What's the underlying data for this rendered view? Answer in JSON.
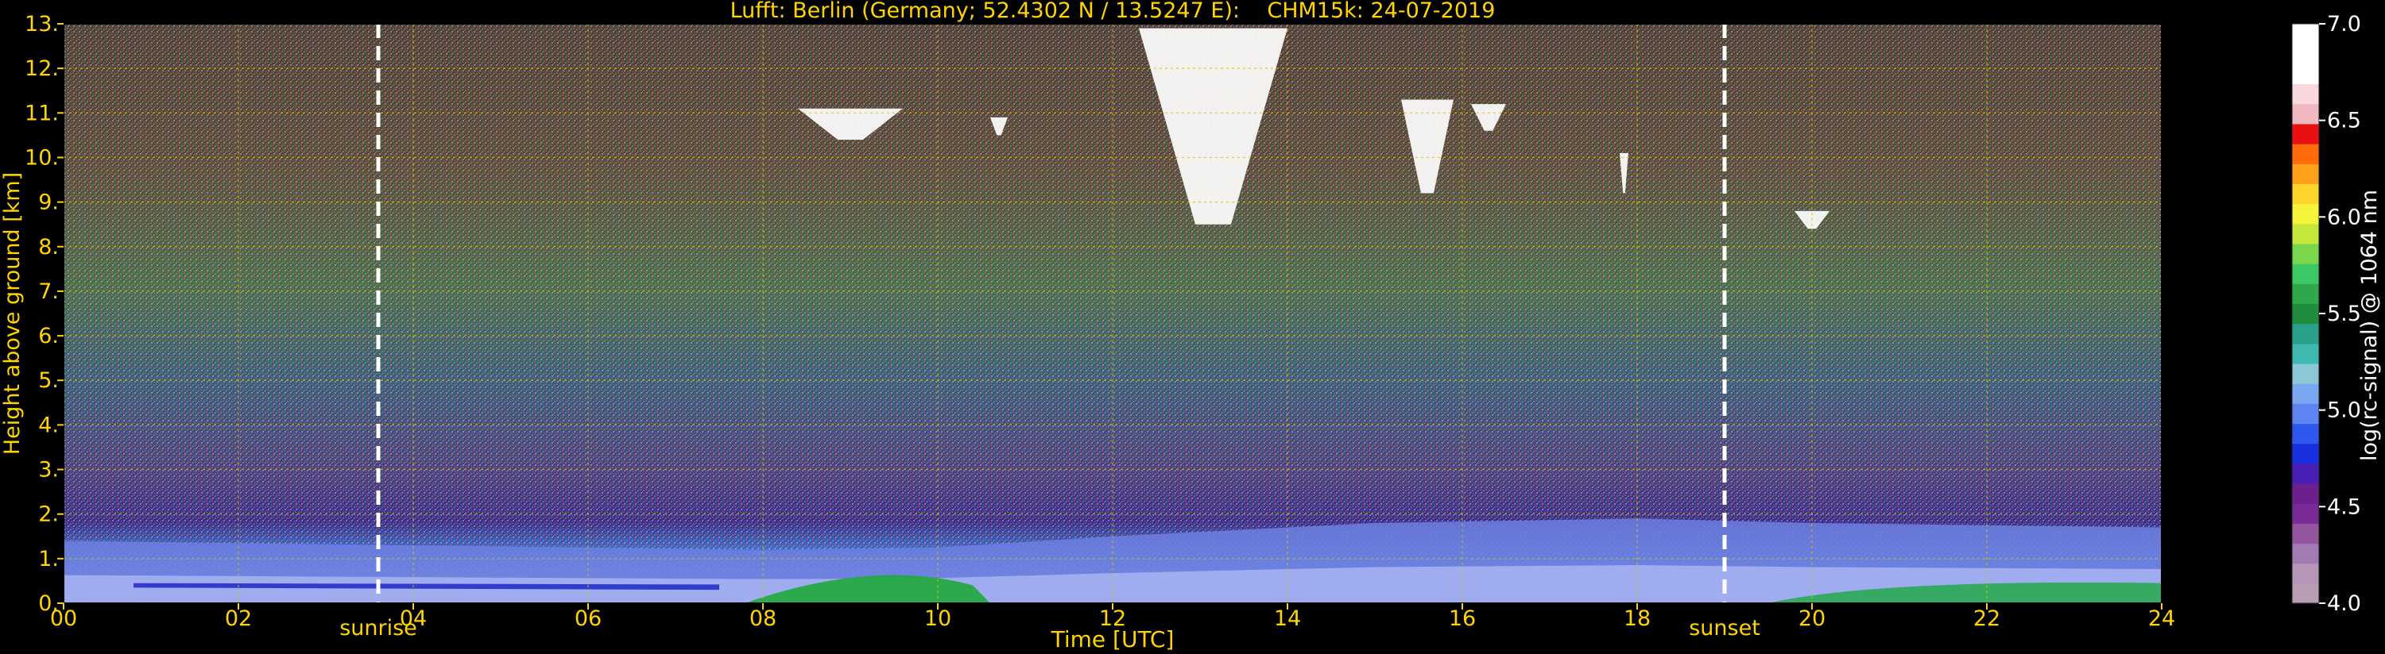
{
  "chart_data": {
    "type": "heatmap",
    "title": "Lufft: Berlin (Germany; 52.4302 N / 13.5247 E):    CHM15k: 24-07-2019",
    "xlabel": "Time [UTC]",
    "ylabel": "Height above ground [km]",
    "x_ticks": [
      "00",
      "02",
      "04",
      "06",
      "08",
      "10",
      "12",
      "14",
      "16",
      "18",
      "20",
      "22",
      "24"
    ],
    "y_ticks": [
      "0.",
      "1.",
      "2.",
      "3.",
      "4.",
      "5.",
      "6.",
      "7.",
      "8.",
      "9.",
      "10.",
      "11.",
      "12.",
      "13."
    ],
    "xlim": [
      0,
      24
    ],
    "ylim": [
      0,
      13
    ],
    "grid": true,
    "colorbar": {
      "label": "log(rc-signal) @ 1064 nm",
      "ticks": [
        "4.0",
        "4.5",
        "5.0",
        "5.5",
        "6.0",
        "6.5",
        "7.0"
      ],
      "range": [
        4.0,
        7.0
      ]
    },
    "annotations": [
      {
        "text": "sunrise",
        "x": 3.6
      },
      {
        "text": "sunset",
        "x": 19.0
      }
    ],
    "features": {
      "boundary_layer_top_km": [
        {
          "x": 0,
          "y": 1.4
        },
        {
          "x": 4,
          "y": 1.3
        },
        {
          "x": 8,
          "y": 1.2
        },
        {
          "x": 10,
          "y": 1.25
        },
        {
          "x": 12,
          "y": 1.5
        },
        {
          "x": 15,
          "y": 1.8
        },
        {
          "x": 18,
          "y": 1.9
        },
        {
          "x": 20,
          "y": 1.8
        },
        {
          "x": 24,
          "y": 1.7
        }
      ],
      "clouds": [
        {
          "x_start": 8.4,
          "x_end": 9.6,
          "y_bottom": 10.4,
          "y_top": 11.1
        },
        {
          "x_start": 10.6,
          "x_end": 10.8,
          "y_bottom": 10.5,
          "y_top": 10.9
        },
        {
          "x_start": 12.3,
          "x_end": 14.0,
          "y_bottom": 8.5,
          "y_top": 12.9
        },
        {
          "x_start": 15.3,
          "x_end": 15.9,
          "y_bottom": 9.2,
          "y_top": 11.3
        },
        {
          "x_start": 16.1,
          "x_end": 16.5,
          "y_bottom": 10.6,
          "y_top": 11.2
        },
        {
          "x_start": 17.8,
          "x_end": 17.9,
          "y_bottom": 9.2,
          "y_top": 10.1
        },
        {
          "x_start": 19.8,
          "x_end": 20.2,
          "y_bottom": 8.4,
          "y_top": 8.8
        }
      ]
    }
  }
}
